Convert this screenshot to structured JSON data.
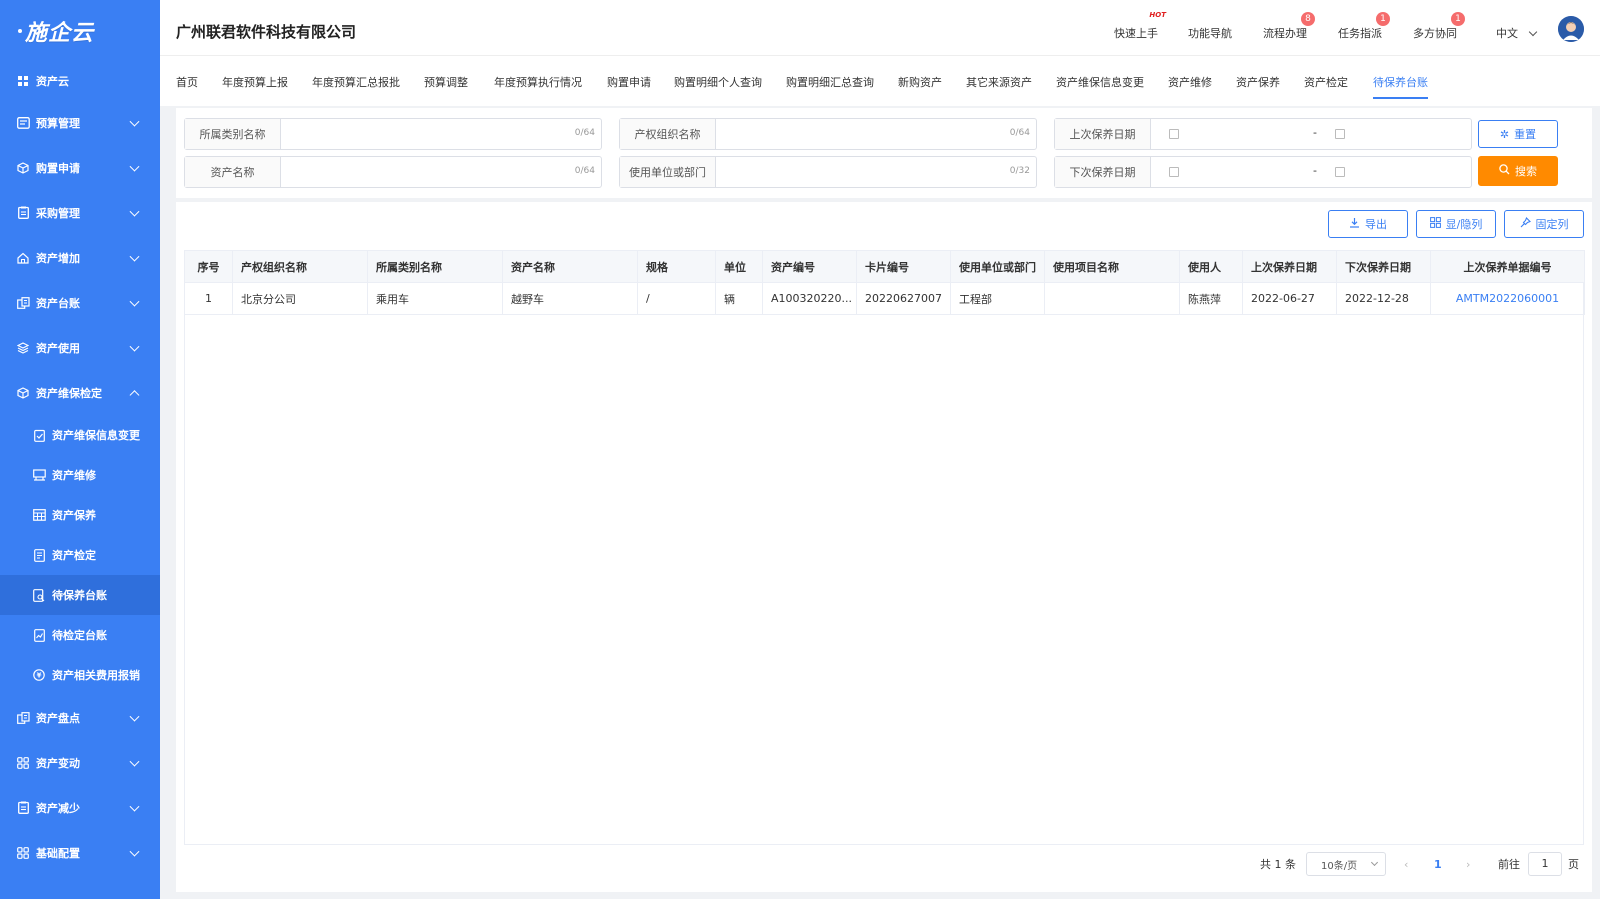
{
  "brand": {
    "logo": "施企云"
  },
  "sidebar": {
    "items": [
      {
        "label": "资产云",
        "icon": "grid-icon"
      },
      {
        "label": "预算管理",
        "icon": "budget-icon"
      },
      {
        "label": "购置申请",
        "icon": "cube-icon"
      },
      {
        "label": "采购管理",
        "icon": "clipboard-icon"
      },
      {
        "label": "资产增加",
        "icon": "home-icon"
      },
      {
        "label": "资产台账",
        "icon": "ledger-icon"
      },
      {
        "label": "资产使用",
        "icon": "layers-icon"
      },
      {
        "label": "资产维保检定",
        "icon": "cube-icon"
      },
      {
        "label": "资产盘点",
        "icon": "ledger-icon"
      },
      {
        "label": "资产变动",
        "icon": "grid4-icon"
      },
      {
        "label": "资产减少",
        "icon": "clipboard-icon"
      },
      {
        "label": "基础配置",
        "icon": "grid4-icon"
      }
    ],
    "subitems": [
      {
        "label": "资产维保信息变更"
      },
      {
        "label": "资产维修"
      },
      {
        "label": "资产保养"
      },
      {
        "label": "资产检定"
      },
      {
        "label": "待保养台账"
      },
      {
        "label": "待检定台账"
      },
      {
        "label": "资产相关费用报销"
      }
    ]
  },
  "header": {
    "company": "广州联君软件科技有限公司",
    "nav": [
      {
        "label": "快速上手",
        "badge": "HOT"
      },
      {
        "label": "功能导航",
        "badge": ""
      },
      {
        "label": "流程办理",
        "badge": "8"
      },
      {
        "label": "任务指派",
        "badge": "1"
      },
      {
        "label": "多方协同",
        "badge": "1"
      }
    ],
    "language": "中文"
  },
  "tabs": [
    "首页",
    "年度预算上报",
    "年度预算汇总报批",
    "预算调整",
    "年度预算执行情况",
    "购置申请",
    "购置明细个人查询",
    "购置明细汇总查询",
    "新购资产",
    "其它来源资产",
    "资产维保信息变更",
    "资产维修",
    "资产保养",
    "资产检定",
    "待保养台账"
  ],
  "active_tab": "待保养台账",
  "filters": {
    "category": {
      "label": "所属类别名称",
      "value": "",
      "count": "0/64"
    },
    "org": {
      "label": "产权组织名称",
      "value": "",
      "count": "0/64"
    },
    "last_date": {
      "label": "上次保养日期",
      "sep": "-"
    },
    "asset_name": {
      "label": "资产名称",
      "value": "",
      "count": "0/64"
    },
    "dept": {
      "label": "使用单位或部门",
      "value": "",
      "count": "0/32"
    },
    "next_date": {
      "label": "下次保养日期",
      "sep": "-"
    },
    "reset": "重置",
    "search": "搜索"
  },
  "toolbar": {
    "export": "导出",
    "toggle_cols": "显/隐列",
    "fix_cols": "固定列"
  },
  "table": {
    "columns": [
      "序号",
      "产权组织名称",
      "所属类别名称",
      "资产名称",
      "规格",
      "单位",
      "资产编号",
      "卡片编号",
      "使用单位或部门",
      "使用项目名称",
      "使用人",
      "上次保养日期",
      "下次保养日期",
      "上次保养单据编号"
    ],
    "rows": [
      [
        "1",
        "北京分公司",
        "乘用车",
        "越野车",
        "/",
        "辆",
        "A100320220...",
        "20220627007",
        "工程部",
        "",
        "陈燕萍",
        "2022-06-27",
        "2022-12-28",
        "AMTM2022060001"
      ]
    ]
  },
  "pager": {
    "total": "共 1 条",
    "page_size": "10条/页",
    "current": "1",
    "goto_label": "前往",
    "goto_value": "1",
    "page_suffix": "页"
  },
  "colors": {
    "primary": "#3a7ff3",
    "sidebar": "#3a7ff3",
    "orange": "#ff8a00",
    "badge": "#f56c6c"
  }
}
